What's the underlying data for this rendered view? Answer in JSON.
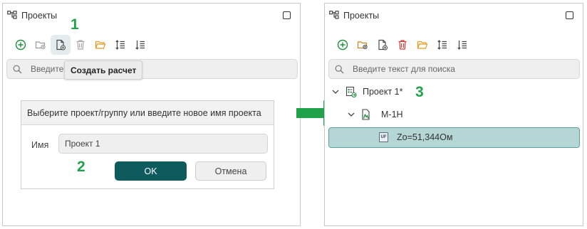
{
  "colors": {
    "accent_green": "#1fa24a",
    "primary_button": "#0d5b5d",
    "selected_row_bg": "#b4d6d5",
    "delete_icon_red": "#d03a3a",
    "folder_orange": "#e59a1f"
  },
  "left": {
    "title": "Проекты",
    "toolbar_icons": [
      "add-circle-icon",
      "new-folder-icon",
      "new-calculation-icon",
      "delete-icon",
      "open-folder-icon",
      "sort-asc-icon",
      "sort-desc-icon"
    ],
    "search_placeholder": "Введите",
    "tooltip": "Создать расчет",
    "step1": "1",
    "step2": "2",
    "dialog": {
      "title": "Выберите проект/группу или введите новое имя проекта",
      "name_label": "Имя",
      "name_value": "Проект 1",
      "ok": "OK",
      "cancel": "Отмена"
    }
  },
  "right": {
    "title": "Проекты",
    "search_placeholder": "Введите текст для поиска",
    "step3": "3",
    "tree": {
      "project": "Проект 1*",
      "calc": "М-1Н",
      "result": "Zo=51,344Ом",
      "result_badge": "UF"
    }
  }
}
